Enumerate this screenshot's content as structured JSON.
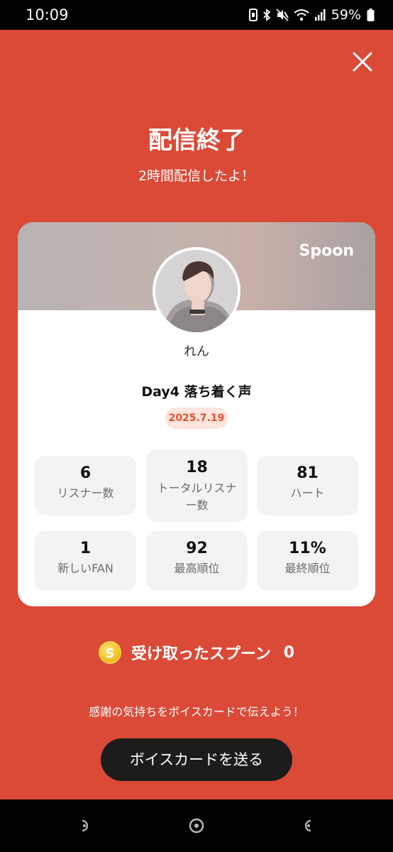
{
  "status_bar": {
    "time": "10:09",
    "battery": "59%",
    "icons": [
      "notification-icon",
      "bluetooth-icon",
      "mute-icon",
      "wifi-icon",
      "signal-icon",
      "battery-icon"
    ]
  },
  "header": {
    "title": "配信終了",
    "subtitle": "2時間配信したよ！"
  },
  "card": {
    "brand": "Spoon",
    "user_name": "れん",
    "stream_title": "Day4 落ち着く声",
    "date": "2025.7.19",
    "stats": [
      {
        "value": "6",
        "label": "リスナー数"
      },
      {
        "value": "18",
        "label_line1": "トータルリスナ",
        "label_line2": "ー数"
      },
      {
        "value": "81",
        "label": "ハート"
      },
      {
        "value": "1",
        "label": "新しいFAN"
      },
      {
        "value": "92",
        "label": "最高順位"
      },
      {
        "value": "11%",
        "label": "最終順位"
      }
    ]
  },
  "spoons": {
    "coin_symbol": "S",
    "label": "受け取ったスプーン",
    "count": "0"
  },
  "footer": {
    "thanks_text": "感謝の気持ちをボイスカードで伝えよう！",
    "voice_card_button": "ボイスカードを送る"
  },
  "colors": {
    "background": "#db4a37",
    "button": "#1c1c1c",
    "date_badge_text": "#e0512f",
    "date_badge_bg": "#fde4dc"
  }
}
